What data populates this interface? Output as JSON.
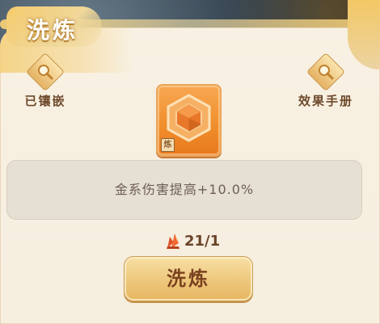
{
  "header": {
    "title": "洗炼"
  },
  "left_button": {
    "label": "已镶嵌",
    "icon": "magnifier-icon"
  },
  "right_button": {
    "label": "效果手册",
    "icon": "magnifier-icon"
  },
  "gem": {
    "icon": "hexagon-gem-icon",
    "tag": "炼",
    "color": "#f08d2b"
  },
  "description": {
    "text": "金系伤害提高+10.0%"
  },
  "cost": {
    "icon": "crystal-shard-icon",
    "count": "21/1"
  },
  "action": {
    "label": "洗炼"
  },
  "colors": {
    "accent": "#edc77b",
    "panel": "#f7efe0",
    "text": "#6d5f52"
  }
}
